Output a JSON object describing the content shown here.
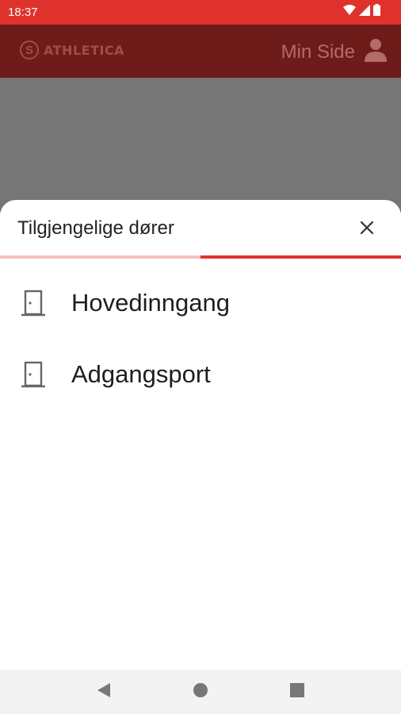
{
  "status_bar": {
    "time": "18:37",
    "icons": [
      "wifi-icon",
      "signal-icon",
      "battery-icon"
    ]
  },
  "app_bar": {
    "brand": "ATHLETICA",
    "account_label": "Min Side",
    "account_icon": "person-icon"
  },
  "sheet": {
    "title": "Tilgjengelige dører",
    "close_icon": "close-icon",
    "progress": 0.5,
    "doors": [
      {
        "label": "Hovedinngang",
        "icon": "door-icon"
      },
      {
        "label": "Adgangsport",
        "icon": "door-icon"
      }
    ]
  },
  "nav_bar": {
    "buttons": [
      "back-icon",
      "home-icon",
      "recents-icon"
    ]
  },
  "colors": {
    "status_bar": "#e0322d",
    "app_bar": "#6e1c1a",
    "accent": "#e0322d",
    "scrim": "#767676"
  }
}
